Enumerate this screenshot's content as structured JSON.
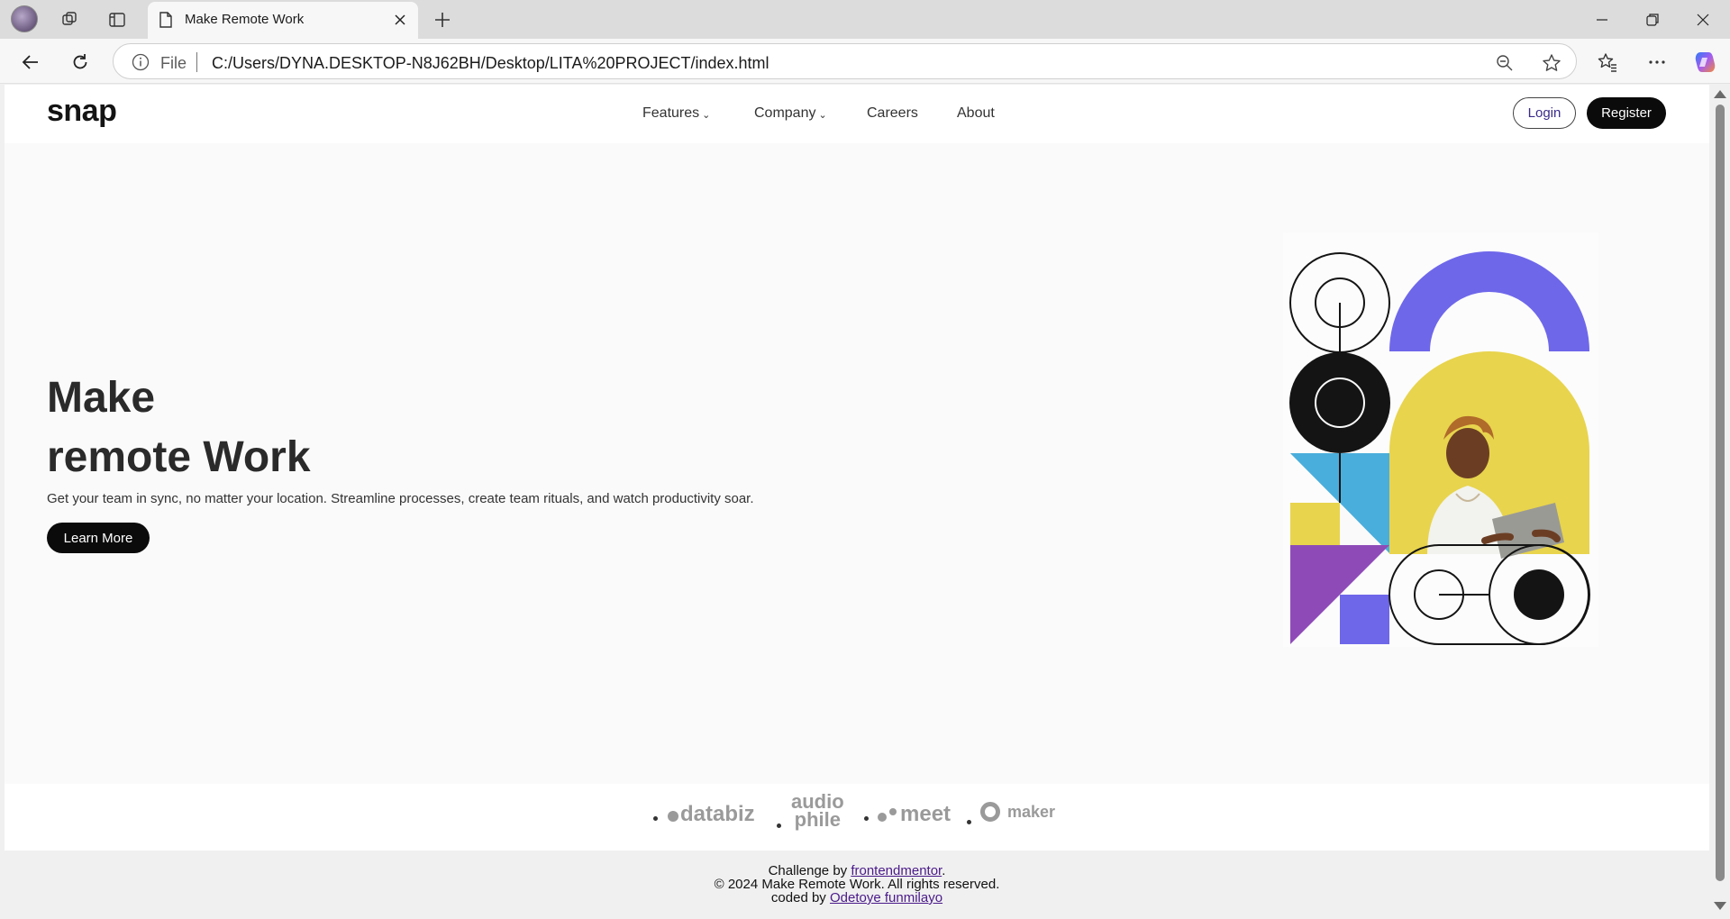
{
  "browser": {
    "tab_title": "Make Remote Work",
    "address_prefix": "File",
    "url": "C:/Users/DYNA.DESKTOP-N8J62BH/Desktop/LITA%20PROJECT/index.html"
  },
  "site": {
    "logo": "snap",
    "nav": {
      "features": "Features",
      "company": "Company",
      "careers": "Careers",
      "about": "About"
    },
    "login": "Login",
    "register": "Register"
  },
  "hero": {
    "title_line1": "Make",
    "title_line2": "remote Work",
    "subtitle": "Get your team in sync, no matter your location. Streamline processes, create team rituals, and watch productivity soar.",
    "cta": "Learn More"
  },
  "brands": {
    "databiz": "databiz",
    "audiophile_top": "audio",
    "audiophile_bottom": "phile",
    "meet": "meet",
    "maker": "maker"
  },
  "footer": {
    "challenge_prefix": "Challenge by",
    "challenge_link": "frontendmentor",
    "challenge_suffix": ".",
    "copyright": "© 2024 Make Remote Work. All rights reserved.",
    "coded_prefix": "coded by",
    "coded_link": "Odetoye funmilayo"
  },
  "colors": {
    "art_purple": "#6e67ea",
    "art_yellow": "#e8d44d",
    "art_blue": "#4aaedc",
    "art_violet": "#8e4bb8",
    "art_black": "#141414"
  }
}
